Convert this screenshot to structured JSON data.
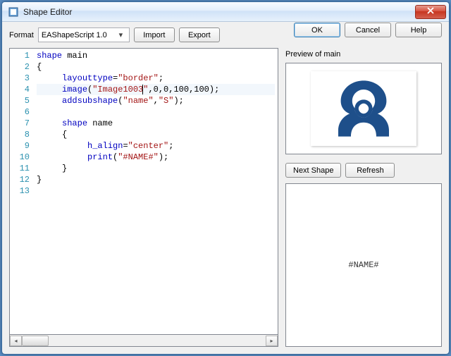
{
  "window": {
    "title": "Shape Editor"
  },
  "toolbar": {
    "format_label": "Format",
    "format_value": "EAShapeScript 1.0",
    "import_label": "Import",
    "export_label": "Export"
  },
  "dialog_buttons": {
    "ok": "OK",
    "cancel": "Cancel",
    "help": "Help"
  },
  "preview": {
    "label": "Preview of main",
    "next_shape": "Next Shape",
    "refresh": "Refresh",
    "name_placeholder": "#NAME#"
  },
  "editor": {
    "lines": [
      {
        "n": 1,
        "indent": 0,
        "tokens": [
          {
            "t": "shape ",
            "c": "kw"
          },
          {
            "t": "main",
            "c": "id"
          }
        ]
      },
      {
        "n": 2,
        "indent": 0,
        "tokens": [
          {
            "t": "{",
            "c": "id"
          }
        ]
      },
      {
        "n": 3,
        "indent": 1,
        "tokens": [
          {
            "t": "layouttype",
            "c": "fn"
          },
          {
            "t": "=",
            "c": "id"
          },
          {
            "t": "\"border\"",
            "c": "str"
          },
          {
            "t": ";",
            "c": "id"
          }
        ]
      },
      {
        "n": 4,
        "indent": 1,
        "hl": true,
        "tokens": [
          {
            "t": "image",
            "c": "fn"
          },
          {
            "t": "(",
            "c": "id"
          },
          {
            "t": "\"Image1003",
            "c": "str"
          },
          {
            "t": "",
            "caret": true
          },
          {
            "t": "\"",
            "c": "str"
          },
          {
            "t": ",0,0,100,100);",
            "c": "id"
          }
        ]
      },
      {
        "n": 5,
        "indent": 1,
        "tokens": [
          {
            "t": "addsubshape",
            "c": "fn"
          },
          {
            "t": "(",
            "c": "id"
          },
          {
            "t": "\"name\"",
            "c": "str"
          },
          {
            "t": ",",
            "c": "id"
          },
          {
            "t": "\"S\"",
            "c": "str"
          },
          {
            "t": ");",
            "c": "id"
          }
        ]
      },
      {
        "n": 6,
        "indent": 0,
        "tokens": []
      },
      {
        "n": 7,
        "indent": 1,
        "tokens": [
          {
            "t": "shape ",
            "c": "kw"
          },
          {
            "t": "name",
            "c": "id"
          }
        ]
      },
      {
        "n": 8,
        "indent": 1,
        "tokens": [
          {
            "t": "{",
            "c": "id"
          }
        ]
      },
      {
        "n": 9,
        "indent": 2,
        "tokens": [
          {
            "t": "h_align",
            "c": "fn"
          },
          {
            "t": "=",
            "c": "id"
          },
          {
            "t": "\"center\"",
            "c": "str"
          },
          {
            "t": ";",
            "c": "id"
          }
        ]
      },
      {
        "n": 10,
        "indent": 2,
        "tokens": [
          {
            "t": "print",
            "c": "fn"
          },
          {
            "t": "(",
            "c": "id"
          },
          {
            "t": "\"#NAME#\"",
            "c": "str"
          },
          {
            "t": ");",
            "c": "id"
          }
        ]
      },
      {
        "n": 11,
        "indent": 1,
        "tokens": [
          {
            "t": "}",
            "c": "id"
          }
        ]
      },
      {
        "n": 12,
        "indent": 0,
        "tokens": [
          {
            "t": "}",
            "c": "id"
          }
        ]
      },
      {
        "n": 13,
        "indent": 0,
        "tokens": []
      }
    ]
  },
  "icons": {
    "logo_color": "#1e4f8a"
  }
}
